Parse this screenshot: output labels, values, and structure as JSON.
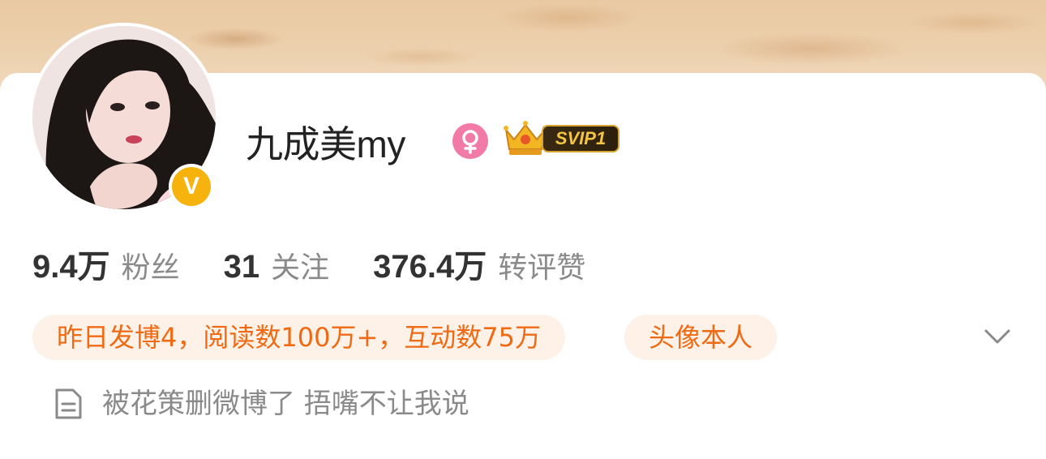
{
  "profile": {
    "name": "九成美my",
    "verified_badge": "V",
    "gender_icon": "female-icon",
    "vip_badge": "SVIP1"
  },
  "stats": [
    {
      "value": "9.4万",
      "label": "粉丝"
    },
    {
      "value": "31",
      "label": "关注"
    },
    {
      "value": "376.4万",
      "label": "转评赞"
    }
  ],
  "tags": {
    "activity": "昨日发博4，阅读数100万+，互动数75万",
    "avatar_verified": "头像本人"
  },
  "bio": {
    "icon": "document-icon",
    "text": "被花策删微博了 捂嘴不让我说"
  },
  "colors": {
    "accent_orange": "#ef6a13",
    "chip_bg": "#fdf1e8",
    "verified_yellow": "#f6b20d",
    "female_pink": "#f27aa6",
    "svip_gold": "#f5c440"
  }
}
